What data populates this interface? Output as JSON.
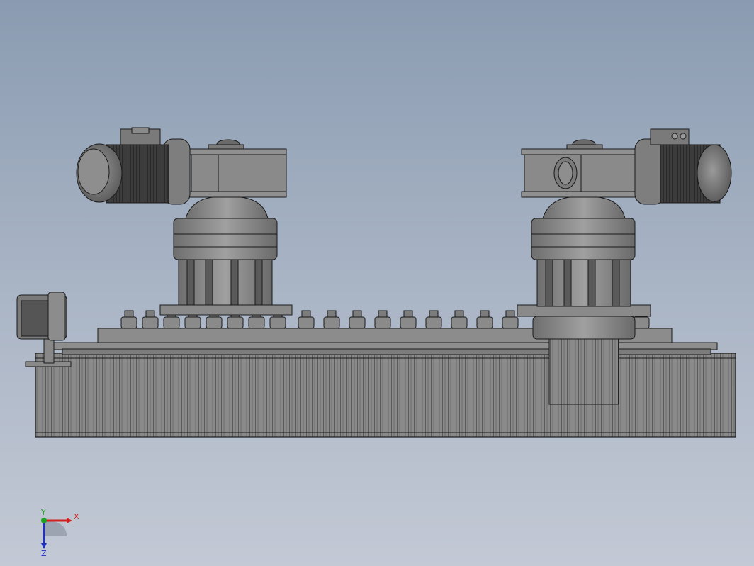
{
  "viewport": {
    "background_top": "#8a9bb1",
    "background_bottom": "#c3c9d5",
    "part_color": "#8c8c8c",
    "edge_color": "#1a1a1a",
    "motor_dark": "#3a3a3a"
  },
  "triad": {
    "x_label": "X",
    "y_label": "Y",
    "z_label": "Z",
    "x_color": "#d02020",
    "y_color": "#20a020",
    "z_color": "#2030c0"
  },
  "icons": [
    "coordinate-triad-icon"
  ]
}
